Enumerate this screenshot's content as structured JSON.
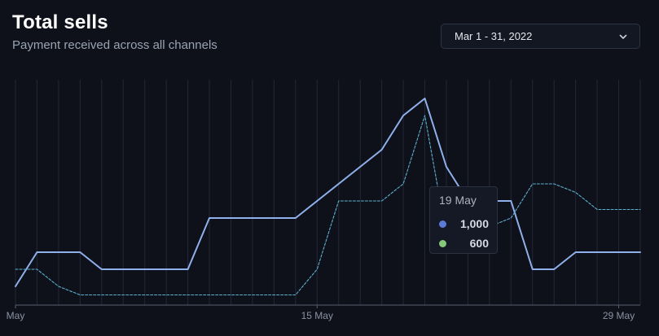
{
  "header": {
    "title": "Total sells",
    "subtitle": "Payment received across all channels"
  },
  "date_range": {
    "label": "Mar 1 - 31, 2022",
    "icon": "chevron-down-icon"
  },
  "tooltip": {
    "date": "19 May",
    "rows": [
      {
        "value": "1,000",
        "color": "#5d7bd6"
      },
      {
        "value": "600",
        "color": "#86c77a"
      }
    ]
  },
  "colors": {
    "background": "#0f111a",
    "series_solid": "#8fb0ea",
    "series_dashed": "#5cb0cf",
    "grid": "#222838",
    "axis": "#5a6070",
    "tick_text": "#8a92a3"
  },
  "chart_data": {
    "type": "line",
    "x": [
      1,
      2,
      3,
      4,
      5,
      6,
      7,
      8,
      9,
      10,
      11,
      12,
      13,
      14,
      15,
      16,
      17,
      18,
      19,
      20,
      21,
      22,
      23,
      24,
      25,
      26,
      27,
      28,
      29,
      30
    ],
    "series": [
      {
        "style": "solid",
        "values": [
          0,
          200,
          200,
          200,
          100,
          100,
          100,
          100,
          100,
          400,
          400,
          400,
          400,
          400,
          500,
          600,
          700,
          800,
          1000,
          1100,
          700,
          500,
          500,
          500,
          100,
          100,
          200,
          200,
          200,
          200
        ]
      },
      {
        "style": "dashed",
        "values": [
          100,
          100,
          0,
          -50,
          -50,
          -50,
          -50,
          -50,
          -50,
          -50,
          -50,
          -50,
          -50,
          -50,
          100,
          500,
          500,
          500,
          600,
          1000,
          300,
          300,
          350,
          400,
          600,
          600,
          550,
          450,
          450,
          450
        ]
      }
    ],
    "x_ticks": [
      {
        "x": 1,
        "label": "May"
      },
      {
        "x": 15,
        "label": "15 May"
      },
      {
        "x": 29,
        "label": "29 May"
      }
    ],
    "ylim": [
      -50,
      1100
    ],
    "grid": "vertical",
    "legend": "none"
  }
}
